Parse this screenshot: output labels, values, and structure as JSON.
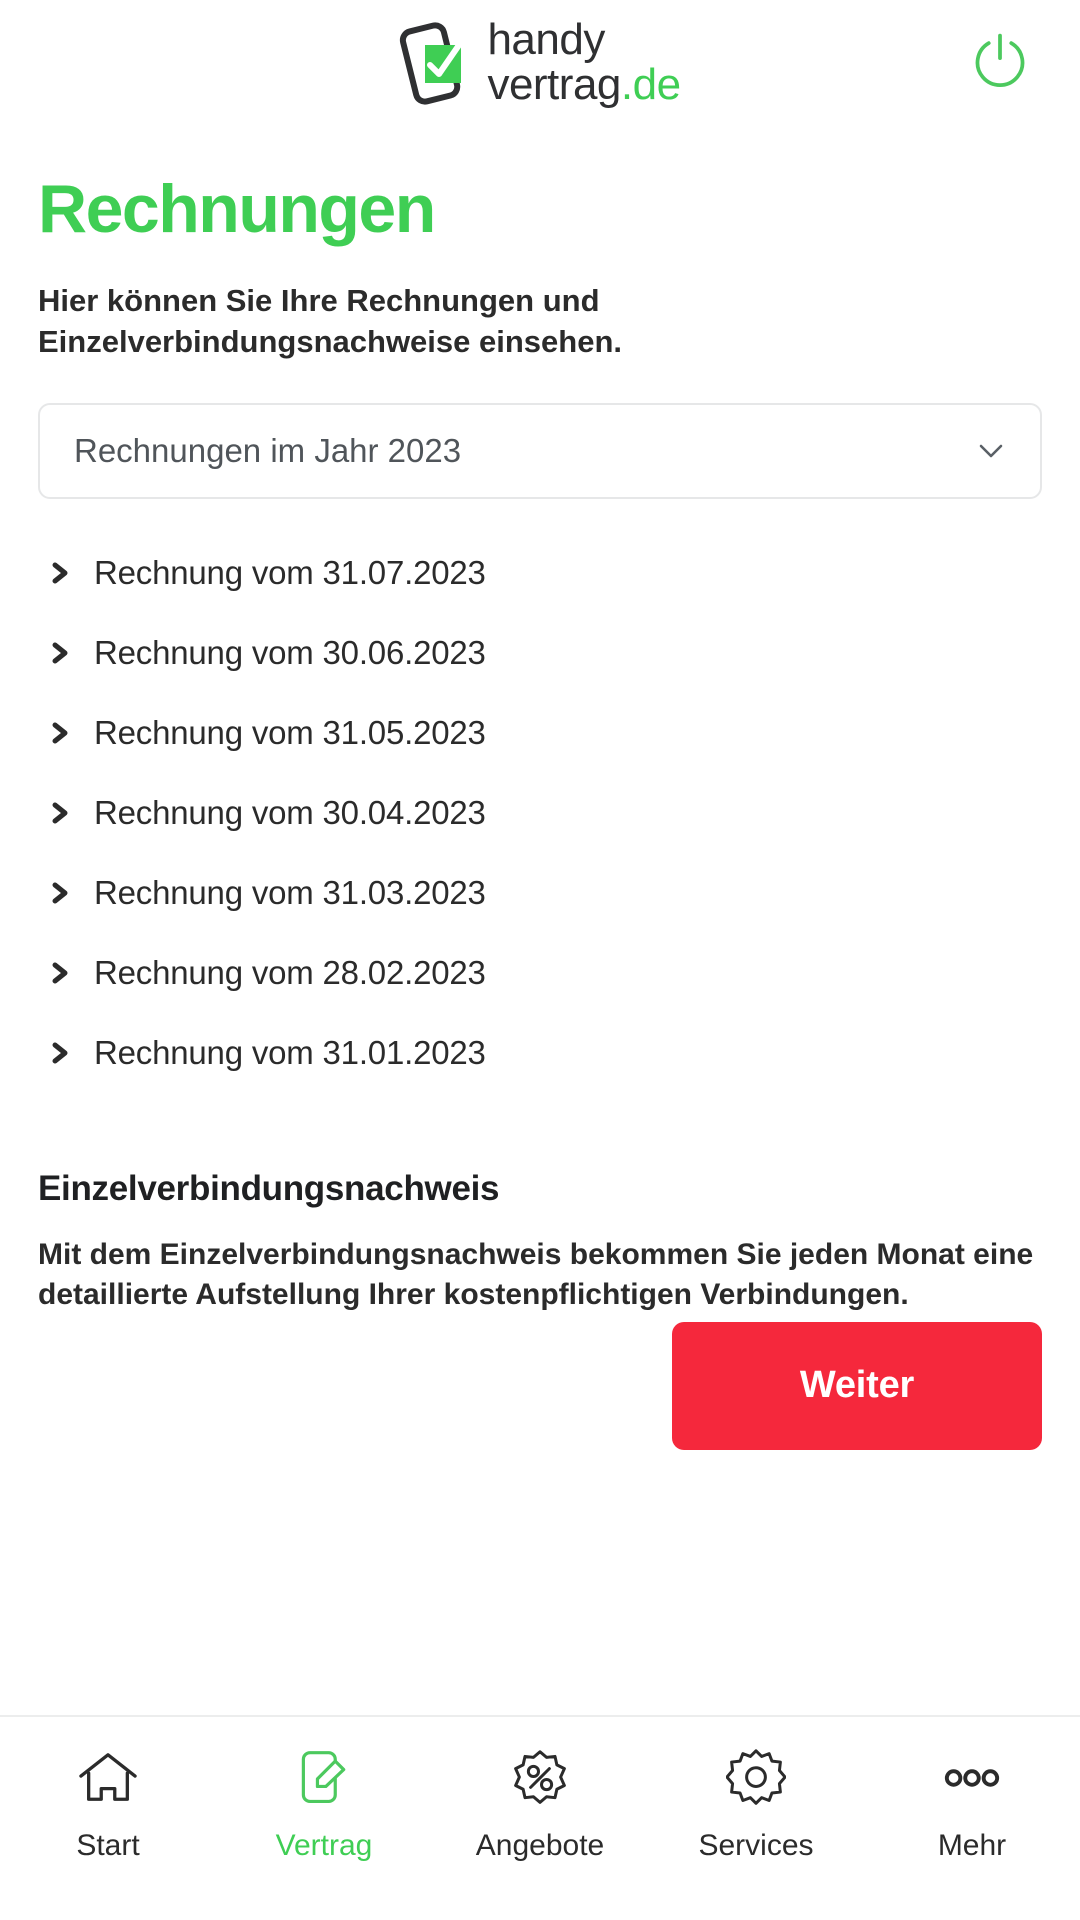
{
  "header": {
    "brand_line1": "handy",
    "brand_line2": "vertrag",
    "brand_suffix": ".de",
    "logo_icon": "phone-check-icon",
    "power_icon": "power-icon",
    "brand_green": "#3fce54"
  },
  "page": {
    "title": "Rechnungen",
    "subtitle": "Hier können Sie Ihre Rechnungen und Einzelverbindungsnachweise einsehen."
  },
  "year_select": {
    "value": "Rechnungen im Jahr 2023",
    "chevron_icon": "chevron-down-icon"
  },
  "invoices": [
    {
      "label": "Rechnung vom 31.07.2023"
    },
    {
      "label": "Rechnung vom 30.06.2023"
    },
    {
      "label": "Rechnung vom 31.05.2023"
    },
    {
      "label": "Rechnung vom 30.04.2023"
    },
    {
      "label": "Rechnung vom 31.03.2023"
    },
    {
      "label": "Rechnung vom 28.02.2023"
    },
    {
      "label": "Rechnung vom 31.01.2023"
    }
  ],
  "evn": {
    "title": "Einzelverbindungsnachweis",
    "text": "Mit dem Einzelverbindungsnachweis bekommen Sie jeden Monat eine detaillierte Aufstellung Ihrer kostenpflichtigen Verbindungen.",
    "button_label": "Weiter",
    "button_color": "#f5283c"
  },
  "bottom_nav": {
    "active_color": "#3fce54",
    "items": [
      {
        "label": "Start",
        "icon": "home-icon",
        "active": false
      },
      {
        "label": "Vertrag",
        "icon": "contract-edit-icon",
        "active": true
      },
      {
        "label": "Angebote",
        "icon": "percent-badge-icon",
        "active": false
      },
      {
        "label": "Services",
        "icon": "gear-icon",
        "active": false
      },
      {
        "label": "Mehr",
        "icon": "ellipsis-icon",
        "active": false
      }
    ]
  }
}
